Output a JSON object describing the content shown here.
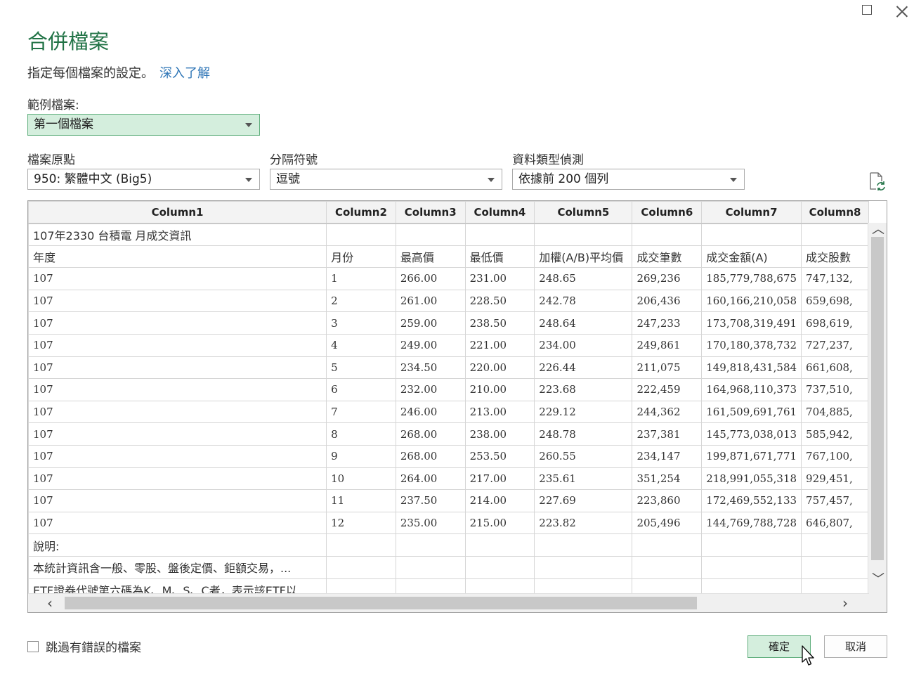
{
  "dialog": {
    "title": "合併檔案",
    "subtitle": "指定每個檔案的設定。",
    "learn_more": "深入了解"
  },
  "sample_file": {
    "label": "範例檔案:",
    "value": "第一個檔案"
  },
  "file_origin": {
    "label": "檔案原點",
    "value": "950: 繁體中文 (Big5)"
  },
  "delimiter": {
    "label": "分隔符號",
    "value": "逗號"
  },
  "data_type_detection": {
    "label": "資料類型偵測",
    "value": "依據前 200 個列"
  },
  "grid": {
    "columns": [
      "Column1",
      "Column2",
      "Column3",
      "Column4",
      "Column5",
      "Column6",
      "Column7",
      "Column8"
    ],
    "rows": [
      [
        "107年2330 台積電 月成交資訊",
        "",
        "",
        "",
        "",
        "",
        "",
        ""
      ],
      [
        "年度",
        "月份",
        "最高價",
        "最低價",
        "加權(A/B)平均價",
        "成交筆數",
        "成交金額(A)",
        "成交股數"
      ],
      [
        "107",
        "1",
        "266.00",
        "231.00",
        "248.65",
        "269,236",
        "185,779,788,675",
        "747,132,"
      ],
      [
        "107",
        "2",
        "261.00",
        "228.50",
        "242.78",
        "206,436",
        "160,166,210,058",
        "659,698,"
      ],
      [
        "107",
        "3",
        "259.00",
        "238.50",
        "248.64",
        "247,233",
        "173,708,319,491",
        "698,619,"
      ],
      [
        "107",
        "4",
        "249.00",
        "221.00",
        "234.00",
        "249,861",
        "170,180,378,732",
        "727,237,"
      ],
      [
        "107",
        "5",
        "234.50",
        "220.00",
        "226.44",
        "211,075",
        "149,818,431,584",
        "661,608,"
      ],
      [
        "107",
        "6",
        "232.00",
        "210.00",
        "223.68",
        "222,459",
        "164,968,110,373",
        "737,510,"
      ],
      [
        "107",
        "7",
        "246.00",
        "213.00",
        "229.12",
        "244,362",
        "161,509,691,761",
        "704,885,"
      ],
      [
        "107",
        "8",
        "268.00",
        "238.00",
        "248.78",
        "237,381",
        "145,773,038,013",
        "585,942,"
      ],
      [
        "107",
        "9",
        "268.00",
        "253.50",
        "260.55",
        "234,147",
        "199,871,671,771",
        "767,100,"
      ],
      [
        "107",
        "10",
        "264.00",
        "217.00",
        "235.61",
        "351,254",
        "218,991,055,318",
        "929,451,"
      ],
      [
        "107",
        "11",
        "237.50",
        "214.00",
        "227.69",
        "223,860",
        "172,469,552,133",
        "757,457,"
      ],
      [
        "107",
        "12",
        "235.00",
        "215.00",
        "223.82",
        "205,496",
        "144,769,788,728",
        "646,807,"
      ],
      [
        "說明:",
        "",
        "",
        "",
        "",
        "",
        "",
        ""
      ],
      [
        "本統計資訊含一般、零股、盤後定價、鉅額交易，...",
        "",
        "",
        "",
        "",
        "",
        "",
        ""
      ],
      [
        "ETF證券代號第六碼為K、M、S、C者，表示該ETF以...",
        "",
        "",
        "",
        "",
        "",
        "",
        ""
      ]
    ]
  },
  "skip_errors": {
    "label": "跳過有錯誤的檔案",
    "checked": false
  },
  "buttons": {
    "ok": "確定",
    "cancel": "取消"
  },
  "colors": {
    "accent_green": "#217346",
    "selected_bg": "#d4eedd",
    "link_blue": "#2e75b6"
  }
}
